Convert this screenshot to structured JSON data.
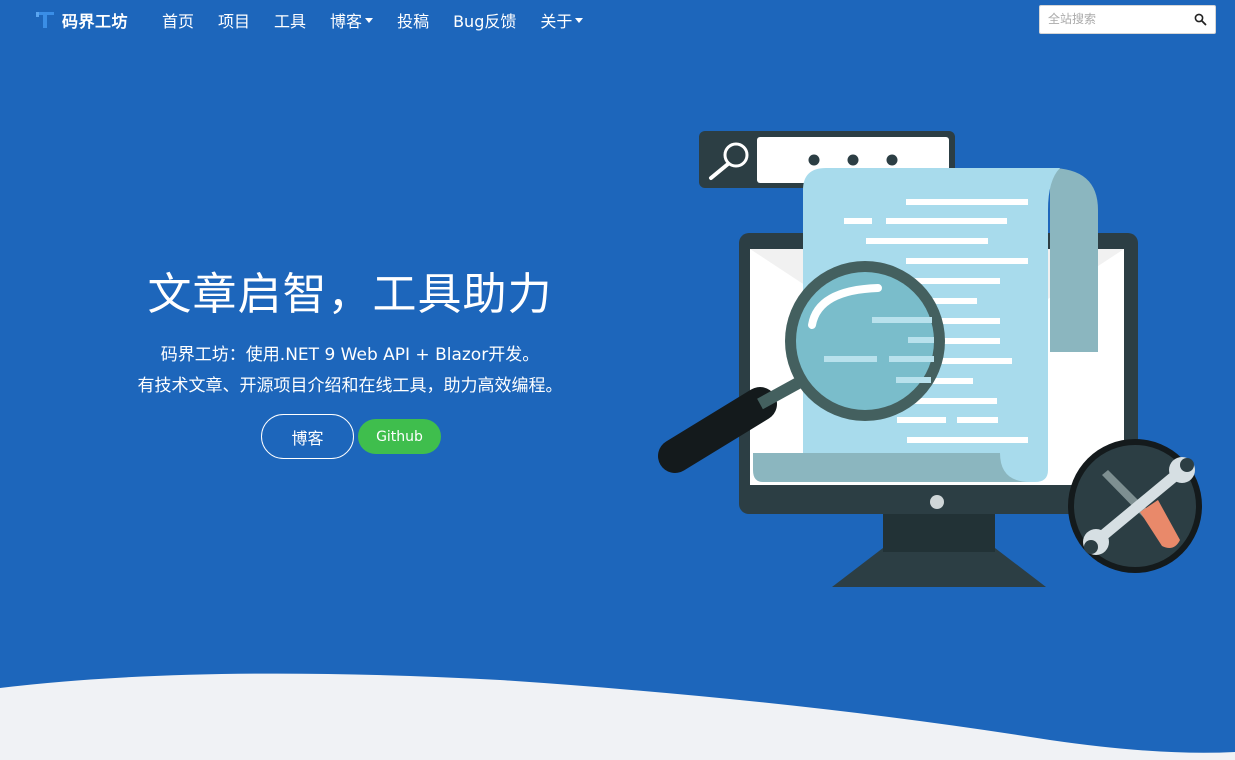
{
  "brand": {
    "name": "码界工坊"
  },
  "nav": {
    "items": [
      {
        "label": "首页",
        "dropdown": false
      },
      {
        "label": "项目",
        "dropdown": false
      },
      {
        "label": "工具",
        "dropdown": false
      },
      {
        "label": "博客",
        "dropdown": true
      },
      {
        "label": "投稿",
        "dropdown": false
      },
      {
        "label": "Bug反馈",
        "dropdown": false
      },
      {
        "label": "关于",
        "dropdown": true
      }
    ]
  },
  "search": {
    "placeholder": "全站搜索",
    "value": ""
  },
  "hero": {
    "title": "文章启智，工具助力",
    "subtitle_line1": "码界工坊：使用.NET 9 Web API + Blazor开发。",
    "subtitle_line2": "有技术文章、开源项目介绍和在线工具，助力高效编程。",
    "blog_button": "博客",
    "github_button": "Github"
  },
  "colors": {
    "background": "#1d66bb",
    "github_button": "#3fbe4d",
    "wave": "#f0f2f5"
  },
  "icons": {
    "brand": "code-window-logo-icon",
    "search": "search-icon",
    "hero_illustration": "monitor-document-magnifier-tools-illustration"
  }
}
